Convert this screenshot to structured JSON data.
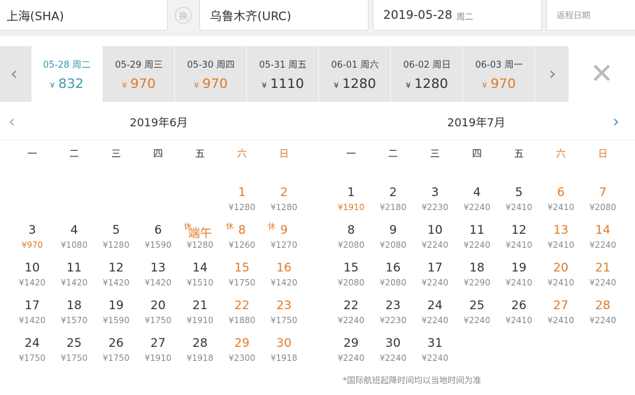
{
  "search": {
    "from": "上海(SHA)",
    "swap_label": "换",
    "to": "乌鲁木齐(URC)",
    "depart_date": "2019-05-28",
    "depart_weekday": "周二",
    "return_placeholder": "返程日期"
  },
  "strip": {
    "prev_icon": "chevron-left-icon",
    "next_icon": "chevron-right-icon",
    "close_icon": "close-icon",
    "currency": "¥",
    "days": [
      {
        "date": "05-28 周二",
        "price": "832",
        "tone": "blue"
      },
      {
        "date": "05-29 周三",
        "price": "970",
        "tone": "orange"
      },
      {
        "date": "05-30 周四",
        "price": "970",
        "tone": "orange"
      },
      {
        "date": "05-31 周五",
        "price": "1110",
        "tone": "normal"
      },
      {
        "date": "06-01 周六",
        "price": "1280",
        "tone": "normal"
      },
      {
        "date": "06-02 周日",
        "price": "1280",
        "tone": "normal"
      },
      {
        "date": "06-03 周一",
        "price": "970",
        "tone": "orange"
      }
    ]
  },
  "calendar": {
    "weekdays": [
      "一",
      "二",
      "三",
      "四",
      "五",
      "六",
      "日"
    ],
    "months": [
      {
        "title": "2019年6月",
        "first_col": 5,
        "days": [
          {
            "d": "1",
            "p": "¥1280"
          },
          {
            "d": "2",
            "p": "¥1280"
          },
          {
            "d": "3",
            "p": "¥970",
            "low": true
          },
          {
            "d": "4",
            "p": "¥1080"
          },
          {
            "d": "5",
            "p": "¥1280"
          },
          {
            "d": "6",
            "p": "¥1590"
          },
          {
            "d": "端午",
            "p": "¥1280",
            "rest": "休"
          },
          {
            "d": "8",
            "p": "¥1260",
            "rest": "休"
          },
          {
            "d": "9",
            "p": "¥1270",
            "rest": "休"
          },
          {
            "d": "10",
            "p": "¥1420"
          },
          {
            "d": "11",
            "p": "¥1420"
          },
          {
            "d": "12",
            "p": "¥1420"
          },
          {
            "d": "13",
            "p": "¥1420"
          },
          {
            "d": "14",
            "p": "¥1510"
          },
          {
            "d": "15",
            "p": "¥1750"
          },
          {
            "d": "16",
            "p": "¥1420"
          },
          {
            "d": "17",
            "p": "¥1420"
          },
          {
            "d": "18",
            "p": "¥1570"
          },
          {
            "d": "19",
            "p": "¥1590"
          },
          {
            "d": "20",
            "p": "¥1750"
          },
          {
            "d": "21",
            "p": "¥1910"
          },
          {
            "d": "22",
            "p": "¥1880"
          },
          {
            "d": "23",
            "p": "¥1750"
          },
          {
            "d": "24",
            "p": "¥1750"
          },
          {
            "d": "25",
            "p": "¥1750"
          },
          {
            "d": "26",
            "p": "¥1750"
          },
          {
            "d": "27",
            "p": "¥1910"
          },
          {
            "d": "28",
            "p": "¥1918"
          },
          {
            "d": "29",
            "p": "¥2300"
          },
          {
            "d": "30",
            "p": "¥1918"
          }
        ]
      },
      {
        "title": "2019年7月",
        "first_col": 0,
        "days": [
          {
            "d": "1",
            "p": "¥1910",
            "low": true
          },
          {
            "d": "2",
            "p": "¥2180"
          },
          {
            "d": "3",
            "p": "¥2230"
          },
          {
            "d": "4",
            "p": "¥2240"
          },
          {
            "d": "5",
            "p": "¥2410"
          },
          {
            "d": "6",
            "p": "¥2410"
          },
          {
            "d": "7",
            "p": "¥2080"
          },
          {
            "d": "8",
            "p": "¥2080"
          },
          {
            "d": "9",
            "p": "¥2080"
          },
          {
            "d": "10",
            "p": "¥2240"
          },
          {
            "d": "11",
            "p": "¥2240"
          },
          {
            "d": "12",
            "p": "¥2410"
          },
          {
            "d": "13",
            "p": "¥2410"
          },
          {
            "d": "14",
            "p": "¥2240"
          },
          {
            "d": "15",
            "p": "¥2080"
          },
          {
            "d": "16",
            "p": "¥2080"
          },
          {
            "d": "17",
            "p": "¥2240"
          },
          {
            "d": "18",
            "p": "¥2290"
          },
          {
            "d": "19",
            "p": "¥2410"
          },
          {
            "d": "20",
            "p": "¥2410"
          },
          {
            "d": "21",
            "p": "¥2240"
          },
          {
            "d": "22",
            "p": "¥2240"
          },
          {
            "d": "23",
            "p": "¥2230"
          },
          {
            "d": "24",
            "p": "¥2240"
          },
          {
            "d": "25",
            "p": "¥2240"
          },
          {
            "d": "26",
            "p": "¥2410"
          },
          {
            "d": "27",
            "p": "¥2410"
          },
          {
            "d": "28",
            "p": "¥2240"
          },
          {
            "d": "29",
            "p": "¥2240"
          },
          {
            "d": "30",
            "p": "¥2240"
          },
          {
            "d": "31",
            "p": "¥2240"
          }
        ]
      }
    ],
    "footnote": "*国际航班起降时间均以当地时间为准"
  },
  "colors": {
    "accent": "#3c96b4",
    "low_price": "#e07a28",
    "weekend": "#e07a28"
  }
}
